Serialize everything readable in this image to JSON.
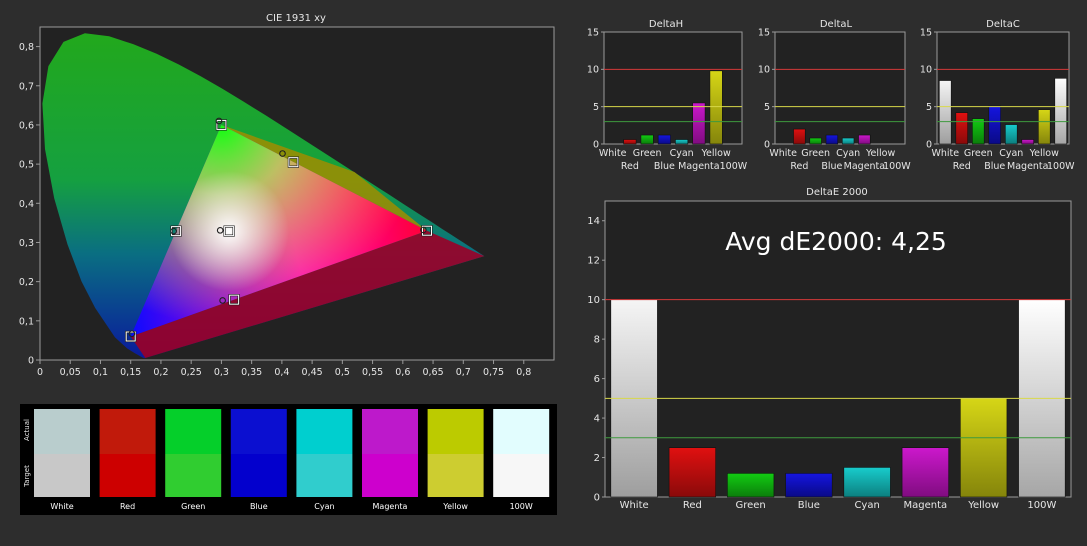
{
  "colors": {
    "background": "#2d2d2d",
    "plot_bg": "#222222",
    "axis": "#9a9a9a",
    "text": "#e6e6e6",
    "red_line": "#d43a3a",
    "yellow_line": "#d8d84a",
    "green_line": "#3e9a3e"
  },
  "chart_data": [
    {
      "id": "cie",
      "type": "scatter",
      "title": "CIE 1931 xy",
      "xlim": [
        0,
        0.85
      ],
      "ylim": [
        0,
        0.85
      ],
      "x_ticks": [
        "0",
        "0,05",
        "0,1",
        "0,15",
        "0,2",
        "0,25",
        "0,3",
        "0,35",
        "0,4",
        "0,45",
        "0,5",
        "0,55",
        "0,6",
        "0,65",
        "0,7",
        "0,75",
        "0,8"
      ],
      "y_ticks": [
        "0",
        "0,1",
        "0,2",
        "0,3",
        "0,4",
        "0,5",
        "0,6",
        "0,7",
        "0,8"
      ],
      "series": [
        {
          "name": "Target",
          "marker": "square",
          "points": [
            {
              "label": "Red",
              "x": 0.64,
              "y": 0.33
            },
            {
              "label": "Green",
              "x": 0.3,
              "y": 0.6
            },
            {
              "label": "Blue",
              "x": 0.15,
              "y": 0.06
            },
            {
              "label": "Cyan",
              "x": 0.225,
              "y": 0.329
            },
            {
              "label": "Magenta",
              "x": 0.321,
              "y": 0.154
            },
            {
              "label": "Yellow",
              "x": 0.419,
              "y": 0.505
            },
            {
              "label": "White",
              "x": 0.3127,
              "y": 0.329
            }
          ]
        },
        {
          "name": "Actual",
          "marker": "circle",
          "points": [
            {
              "label": "Red",
              "x": 0.634,
              "y": 0.332
            },
            {
              "label": "Green",
              "x": 0.296,
              "y": 0.61
            },
            {
              "label": "Blue",
              "x": 0.152,
              "y": 0.067
            },
            {
              "label": "Cyan",
              "x": 0.221,
              "y": 0.329
            },
            {
              "label": "Magenta",
              "x": 0.302,
              "y": 0.152
            },
            {
              "label": "Yellow",
              "x": 0.401,
              "y": 0.527
            },
            {
              "label": "White",
              "x": 0.298,
              "y": 0.331
            }
          ]
        }
      ]
    },
    {
      "id": "deltaH",
      "type": "bar",
      "title": "DeltaH",
      "ylim": [
        0,
        15
      ],
      "y_ticks": [
        0,
        5,
        10,
        15
      ],
      "categories": [
        "White",
        "Red",
        "Green",
        "Blue",
        "Cyan",
        "Magenta",
        "Yellow",
        "100W"
      ],
      "values": [
        0,
        0.6,
        1.2,
        1.2,
        0.6,
        5.5,
        9.8,
        0
      ],
      "thresholds": [
        10,
        5,
        3
      ]
    },
    {
      "id": "deltaL",
      "type": "bar",
      "title": "DeltaL",
      "ylim": [
        0,
        15
      ],
      "y_ticks": [
        0,
        5,
        10,
        15
      ],
      "categories": [
        "White",
        "Red",
        "Green",
        "Blue",
        "Cyan",
        "Magenta",
        "Yellow",
        "100W"
      ],
      "values": [
        0,
        2.0,
        0.8,
        1.2,
        0.8,
        1.2,
        0,
        0
      ],
      "thresholds": [
        10,
        5,
        3
      ]
    },
    {
      "id": "deltaC",
      "type": "bar",
      "title": "DeltaC",
      "ylim": [
        0,
        15
      ],
      "y_ticks": [
        0,
        5,
        10,
        15
      ],
      "categories": [
        "White",
        "Red",
        "Green",
        "Blue",
        "Cyan",
        "Magenta",
        "Yellow",
        "100W"
      ],
      "values": [
        8.5,
        4.2,
        3.4,
        5.1,
        2.6,
        0.6,
        4.6,
        8.8
      ],
      "thresholds": [
        10,
        5,
        3
      ]
    },
    {
      "id": "deltaE",
      "type": "bar",
      "title": "DeltaE 2000",
      "annotation": "Avg dE2000: 4,25",
      "ylim": [
        0,
        15
      ],
      "y_ticks": [
        0,
        2,
        4,
        6,
        8,
        10,
        12,
        14
      ],
      "categories": [
        "White",
        "Red",
        "Green",
        "Blue",
        "Cyan",
        "Magenta",
        "Yellow",
        "100W"
      ],
      "values": [
        10.0,
        2.5,
        1.2,
        1.2,
        1.5,
        2.5,
        5.0,
        10.0
      ],
      "thresholds": [
        10,
        5,
        3
      ]
    }
  ],
  "bar_colors": {
    "White": [
      "#f5f5f5",
      "#9e9e9e"
    ],
    "Red": [
      "#e01010",
      "#8a0a0a"
    ],
    "Green": [
      "#12cc12",
      "#0b7d0b"
    ],
    "Blue": [
      "#1515e0",
      "#0a0a86"
    ],
    "Cyan": [
      "#18cccc",
      "#0c7f7f"
    ],
    "Magenta": [
      "#cc18cc",
      "#800c80"
    ],
    "Yellow": [
      "#d6d616",
      "#85850b"
    ],
    "100W": [
      "#ffffff",
      "#a6a6a6"
    ]
  },
  "swatches": {
    "actual_label": "Actual",
    "target_label": "Target",
    "items": [
      {
        "label": "White",
        "actual": "#b9cdcd",
        "target": "#c8c8c8"
      },
      {
        "label": "Red",
        "actual": "#c11a0b",
        "target": "#cd0000"
      },
      {
        "label": "Green",
        "actual": "#05cf2a",
        "target": "#30cd30"
      },
      {
        "label": "Blue",
        "actual": "#0b0fd0",
        "target": "#0300cd"
      },
      {
        "label": "Cyan",
        "actual": "#00cfcf",
        "target": "#30cdcd"
      },
      {
        "label": "Magenta",
        "actual": "#bd19cb",
        "target": "#cd00cd"
      },
      {
        "label": "Yellow",
        "actual": "#bccb00",
        "target": "#cdcd30"
      },
      {
        "label": "100W",
        "actual": "#e2fdfe",
        "target": "#f7f7f7"
      }
    ]
  }
}
